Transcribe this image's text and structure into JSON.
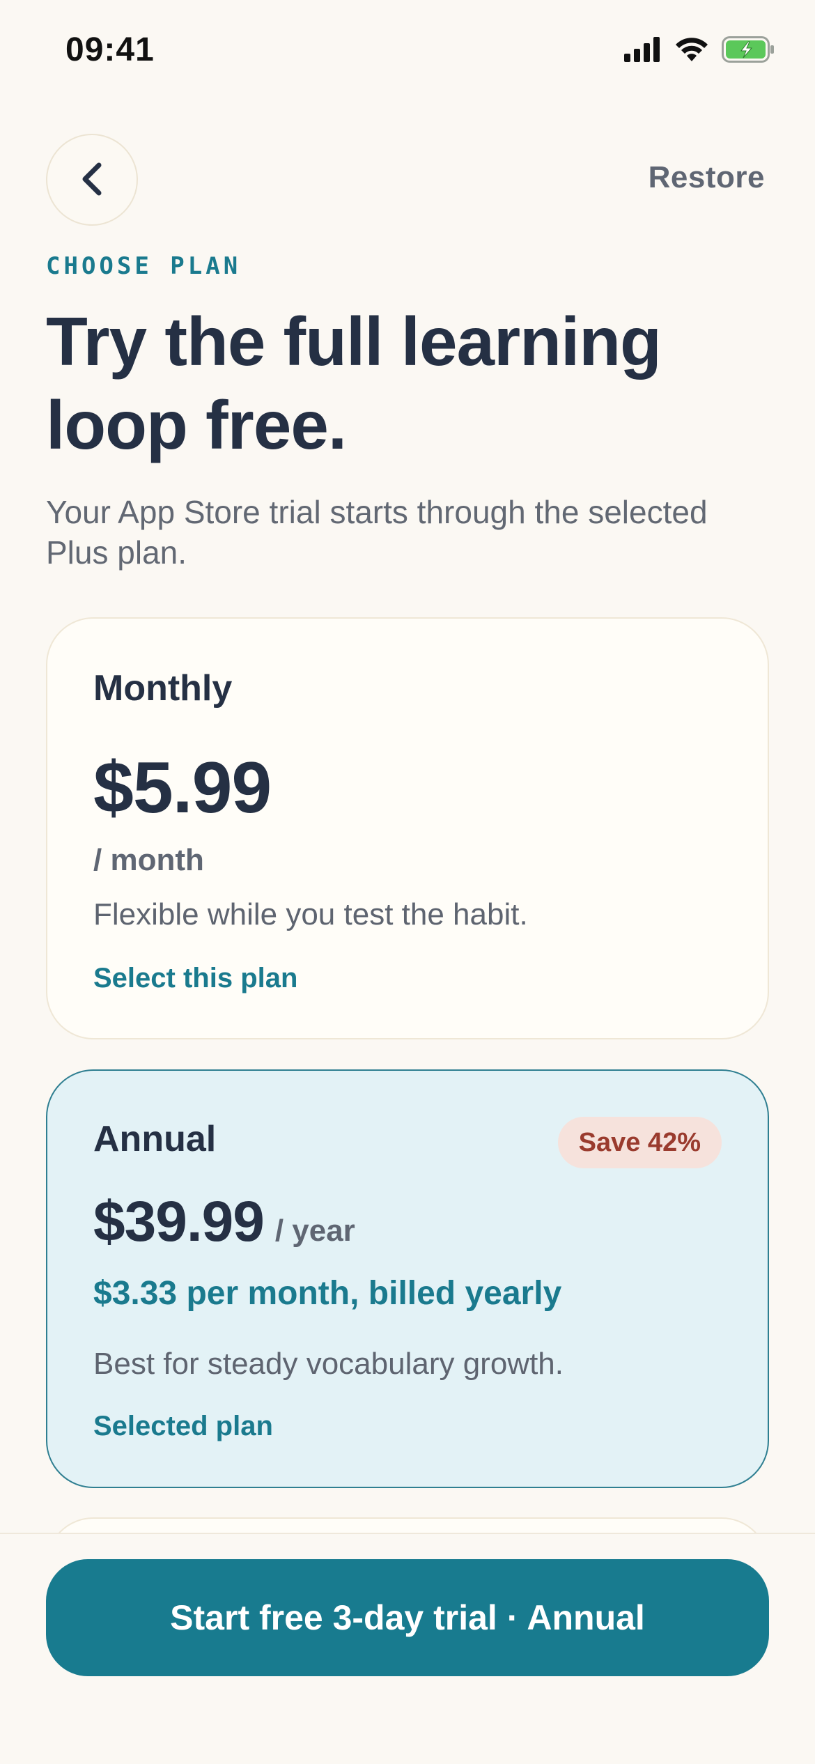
{
  "status_bar": {
    "time": "09:41",
    "icons": [
      "cellular-signal-icon",
      "wifi-icon",
      "battery-charging-icon"
    ],
    "battery_color": "#5BC85A"
  },
  "nav": {
    "back_icon": "chevron-left-icon",
    "restore_label": "Restore"
  },
  "header": {
    "eyebrow": "CHOOSE PLAN",
    "title": "Try the full learning loop free.",
    "subtitle": "Your App Store trial starts through the selected Plus plan."
  },
  "plans": [
    {
      "name": "Monthly",
      "price": "$5.99",
      "period": "/ month",
      "description": "Flexible while you test the habit.",
      "action": "Select this plan",
      "selected": false
    },
    {
      "name": "Annual",
      "badge": "Save 42%",
      "price": "$39.99",
      "period": "/ year",
      "per_month": "$3.33 per month, billed yearly",
      "description": "Best for steady vocabulary growth.",
      "action": "Selected plan",
      "selected": true
    }
  ],
  "cta": {
    "label": "Start free 3-day trial · Annual"
  },
  "colors": {
    "background": "#FBF8F3",
    "accent": "#187B8F",
    "text_primary": "#253044",
    "text_secondary": "#626873",
    "selected_card": "#E3F2F6",
    "badge_bg": "#F6E2DC",
    "badge_text": "#9A3B2E"
  }
}
